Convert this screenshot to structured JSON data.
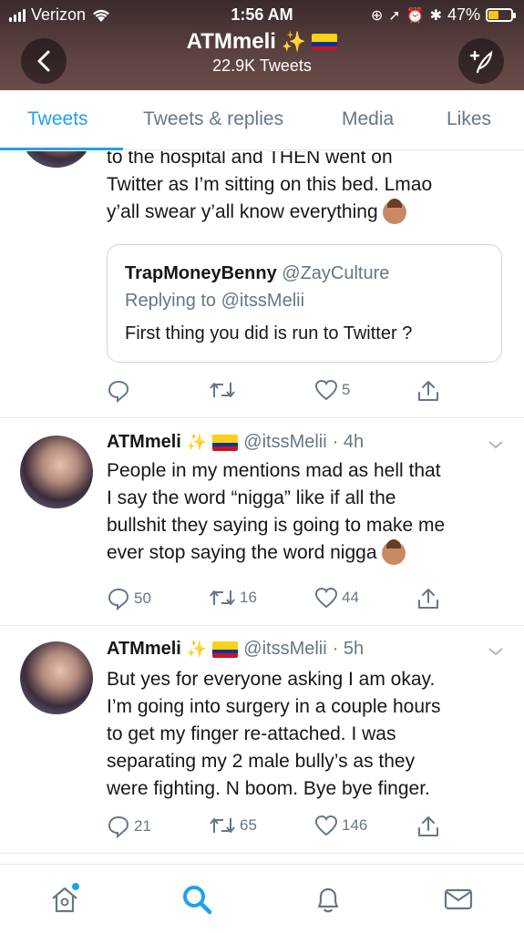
{
  "status": {
    "carrier": "Verizon",
    "time": "1:56 AM",
    "battery": "47%"
  },
  "header": {
    "name": "ATMmeli",
    "tweets_count": "22.9K Tweets"
  },
  "tabs": [
    {
      "label": "Tweets"
    },
    {
      "label": "Tweets & replies"
    },
    {
      "label": "Media"
    },
    {
      "label": "Likes"
    }
  ],
  "tweet1": {
    "lines": [
      "to the hospital and THEN went on",
      "Twitter as I’m sitting on this bed. Lmao",
      "y’all swear y’all know everything"
    ],
    "quote": {
      "name": "TrapMoneyBenny",
      "handle": "@ZayCulture",
      "replying": "Replying to @itssMelii",
      "text": "First thing you did is run to Twitter ?"
    },
    "likes": "5"
  },
  "tweet2": {
    "name": "ATMmeli",
    "handle": "@itssMelii",
    "time": "· 4h",
    "lines": [
      "People in my mentions mad as hell that",
      "I say the word “nigga” like if all the",
      "bullshit they saying is going to make me",
      "ever stop saying the word nigga"
    ],
    "replies": "50",
    "retweets": "16",
    "likes": "44"
  },
  "tweet3": {
    "name": "ATMmeli",
    "handle": "@itssMelii",
    "time": "· 5h",
    "lines": [
      "But yes for everyone asking I am okay.",
      "I’m going into surgery in a couple hours",
      "to get my finger re-attached. I was",
      "separating my 2 male bully’s as they",
      "were fighting. N boom. Bye bye finger."
    ],
    "replies": "21",
    "retweets": "65",
    "likes": "146"
  },
  "colors": {
    "accent": "#1da1f2",
    "muted": "#657786"
  },
  "icons": [
    "back-icon",
    "compose-icon",
    "reply-icon",
    "retweet-icon",
    "like-icon",
    "share-icon",
    "home-icon",
    "search-icon",
    "notifications-icon",
    "messages-icon"
  ]
}
